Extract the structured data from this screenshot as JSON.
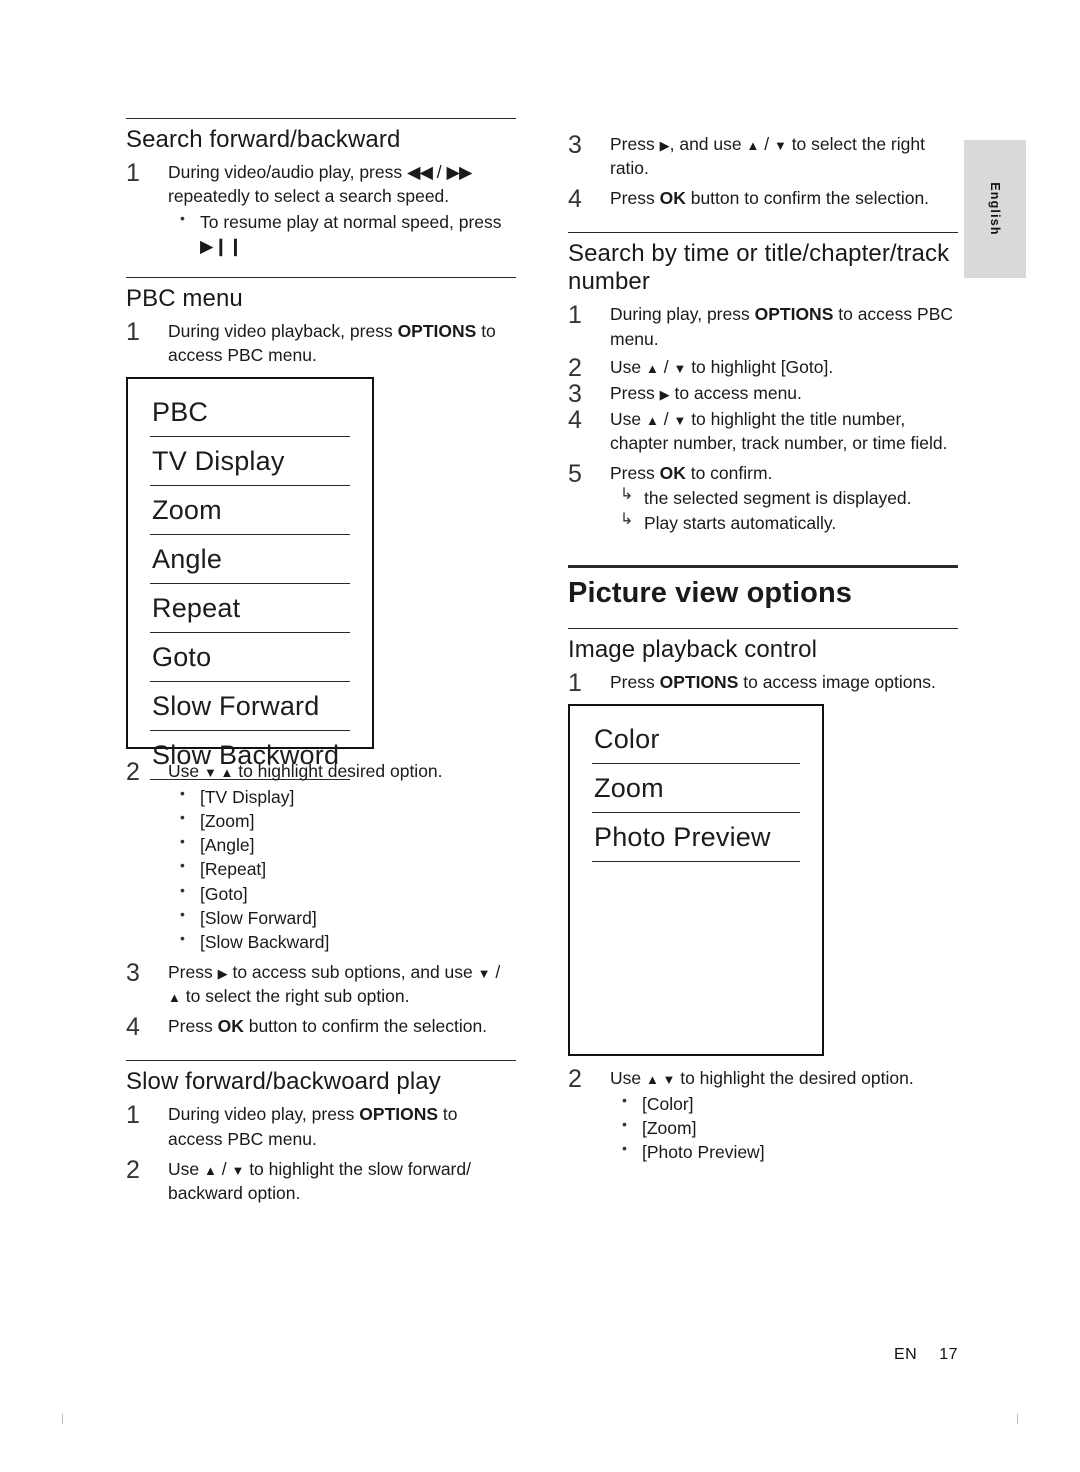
{
  "side_tab": {
    "label": "English"
  },
  "footer": {
    "lang": "EN",
    "page": "17"
  },
  "left": {
    "s1": {
      "heading": "Search forward/backward",
      "steps": [
        {
          "num": "1",
          "text_a": "During video/audio play, press ",
          "ff_rev": "◀◀",
          "slash": " / ",
          "ff_fwd": "▶▶",
          "text_b": " repeatedly to select a search speed.",
          "bullets": [
            {
              "a": "To resume play at normal speed, press ",
              "icon": "▶❙❙"
            }
          ]
        }
      ]
    },
    "s2": {
      "heading": "PBC menu",
      "step1_a": "During video playback, press ",
      "step1_bold": "OPTIONS",
      "step1_b": " to access PBC menu.",
      "osd_title": "PBC",
      "osd_rows": [
        "PBC",
        "TV Display",
        "Zoom",
        "Angle",
        "Repeat",
        "Goto",
        "Slow Forward",
        "Slow Backword"
      ],
      "step2_a": "Use ",
      "step2_icons": "▼ ▲",
      "step2_b": " to highlight desired option.",
      "options": [
        "[TV Display]",
        "[Zoom]",
        "[Angle]",
        "[Repeat]",
        "[Goto]",
        "[Slow Forward]",
        "[Slow Backward]"
      ],
      "step3_a": "Press ",
      "step3_icon1": "▶",
      "step3_b": " to access sub options, and use ",
      "step3_icon2": "▼",
      "step3_slash": " / ",
      "step3_icon3": "▲",
      "step3_c": " to select the right sub option.",
      "step4_a": "Press ",
      "step4_bold": "OK",
      "step4_b": " button to confirm the selection."
    },
    "s3": {
      "heading": "Slow forward/backwoard play",
      "step1_a": "During video play, press ",
      "step1_bold": "OPTIONS",
      "step1_b": " to access PBC menu.",
      "step2_a": "Use ",
      "step2_icon1": "▲",
      "step2_slash": " / ",
      "step2_icon2": "▼",
      "step2_b": " to highlight the slow forward/ backward option."
    }
  },
  "right": {
    "cont": {
      "step3_a": "Press ",
      "step3_icon": "▶",
      "step3_b": ", and use ",
      "step3_icon2": "▲",
      "step3_slash": " / ",
      "step3_icon3": "▼",
      "step3_c": " to select the right ratio.",
      "step4_a": "Press ",
      "step4_bold": "OK",
      "step4_b": " button to confirm the selection."
    },
    "s1": {
      "heading": "Search by time or title/chapter/track number",
      "step1_a": "During play, press ",
      "step1_bold": "OPTIONS",
      "step1_b": " to access PBC menu.",
      "step2_a": "Use ",
      "step2_icon1": "▲",
      "step2_slash": " / ",
      "step2_icon2": "▼",
      "step2_b": " to highlight [Goto].",
      "step3_a": "Press ",
      "step3_icon": "▶",
      "step3_b": " to access menu.",
      "step4_a": " Use ",
      "step4_icon1": "▲",
      "step4_slash": " / ",
      "step4_icon2": "▼",
      "step4_b": " to highlight the title number, chapter number, track number, or time field.",
      "step5_a": "Press ",
      "step5_bold": "OK",
      "step5_b": " to confirm.",
      "step5_arrows": [
        "the selected segment is displayed.",
        "Play starts automatically."
      ]
    },
    "s2": {
      "title": "Picture view options",
      "heading": "Image playback control",
      "step1_a": "Press ",
      "step1_bold": "OPTIONS",
      "step1_b": " to access image options.",
      "osd_rows": [
        "Color",
        "Zoom",
        "Photo Preview"
      ],
      "step2_a": "Use ",
      "step2_icons": "▲ ▼",
      "step2_b": " to highlight the desired option.",
      "options": [
        "[Color]",
        "[Zoom]",
        "[Photo Preview]"
      ]
    }
  }
}
